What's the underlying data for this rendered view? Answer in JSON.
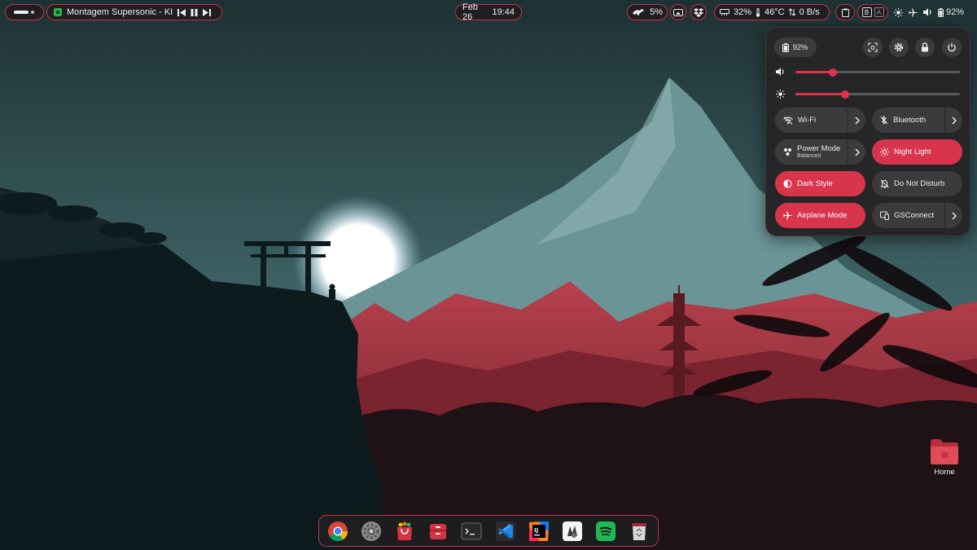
{
  "top_bar": {
    "activities": {
      "icon": "workspace-indicator-icon"
    },
    "media": {
      "app_icon": "supersonic-app-icon",
      "title": "Montagem Supersonic - KI",
      "controls": [
        "previous-icon",
        "pause-icon",
        "next-icon"
      ]
    },
    "clock": {
      "date": "Feb 26",
      "time": "19:44"
    },
    "cpu": {
      "icon": "cpu-runner-icon",
      "value": "5%"
    },
    "system": {
      "memory": "32%",
      "temperature": "46°C",
      "network": "0 B/s"
    },
    "keyboard": {
      "key1": "B",
      "key2": "A"
    },
    "status": {
      "battery": "92%"
    }
  },
  "quick_settings": {
    "battery_label": "92%",
    "volume_level": 0.23,
    "brightness_level": 0.3,
    "tiles": [
      {
        "label": "Wi-Fi",
        "sub": "",
        "icon": "wifi-off-icon",
        "active": false,
        "has_arrow": true
      },
      {
        "label": "Bluetooth",
        "sub": "",
        "icon": "bluetooth-off-icon",
        "active": false,
        "has_arrow": true
      },
      {
        "label": "Power Mode",
        "sub": "Balanced",
        "icon": "power-mode-icon",
        "active": false,
        "has_arrow": true
      },
      {
        "label": "Night Light",
        "sub": "",
        "icon": "night-light-icon",
        "active": true,
        "has_arrow": false
      },
      {
        "label": "Dark Style",
        "sub": "",
        "icon": "dark-style-icon",
        "active": true,
        "has_arrow": false
      },
      {
        "label": "Do Not Disturb",
        "sub": "",
        "icon": "bell-off-icon",
        "active": false,
        "has_arrow": false
      },
      {
        "label": "Airplane Mode",
        "sub": "",
        "icon": "airplane-icon",
        "active": true,
        "has_arrow": false
      },
      {
        "label": "GSConnect",
        "sub": "",
        "icon": "gsconnect-icon",
        "active": false,
        "has_arrow": true
      }
    ]
  },
  "desktop": {
    "home_label": "Home"
  },
  "dock": {
    "apps": [
      "chrome",
      "settings",
      "software-center",
      "files",
      "terminal",
      "vscode",
      "intellij",
      "inkscape",
      "spotify",
      "trash"
    ]
  },
  "colors": {
    "accent": "#d8354c",
    "panel": "#262628",
    "tile": "#3b3b3e"
  }
}
